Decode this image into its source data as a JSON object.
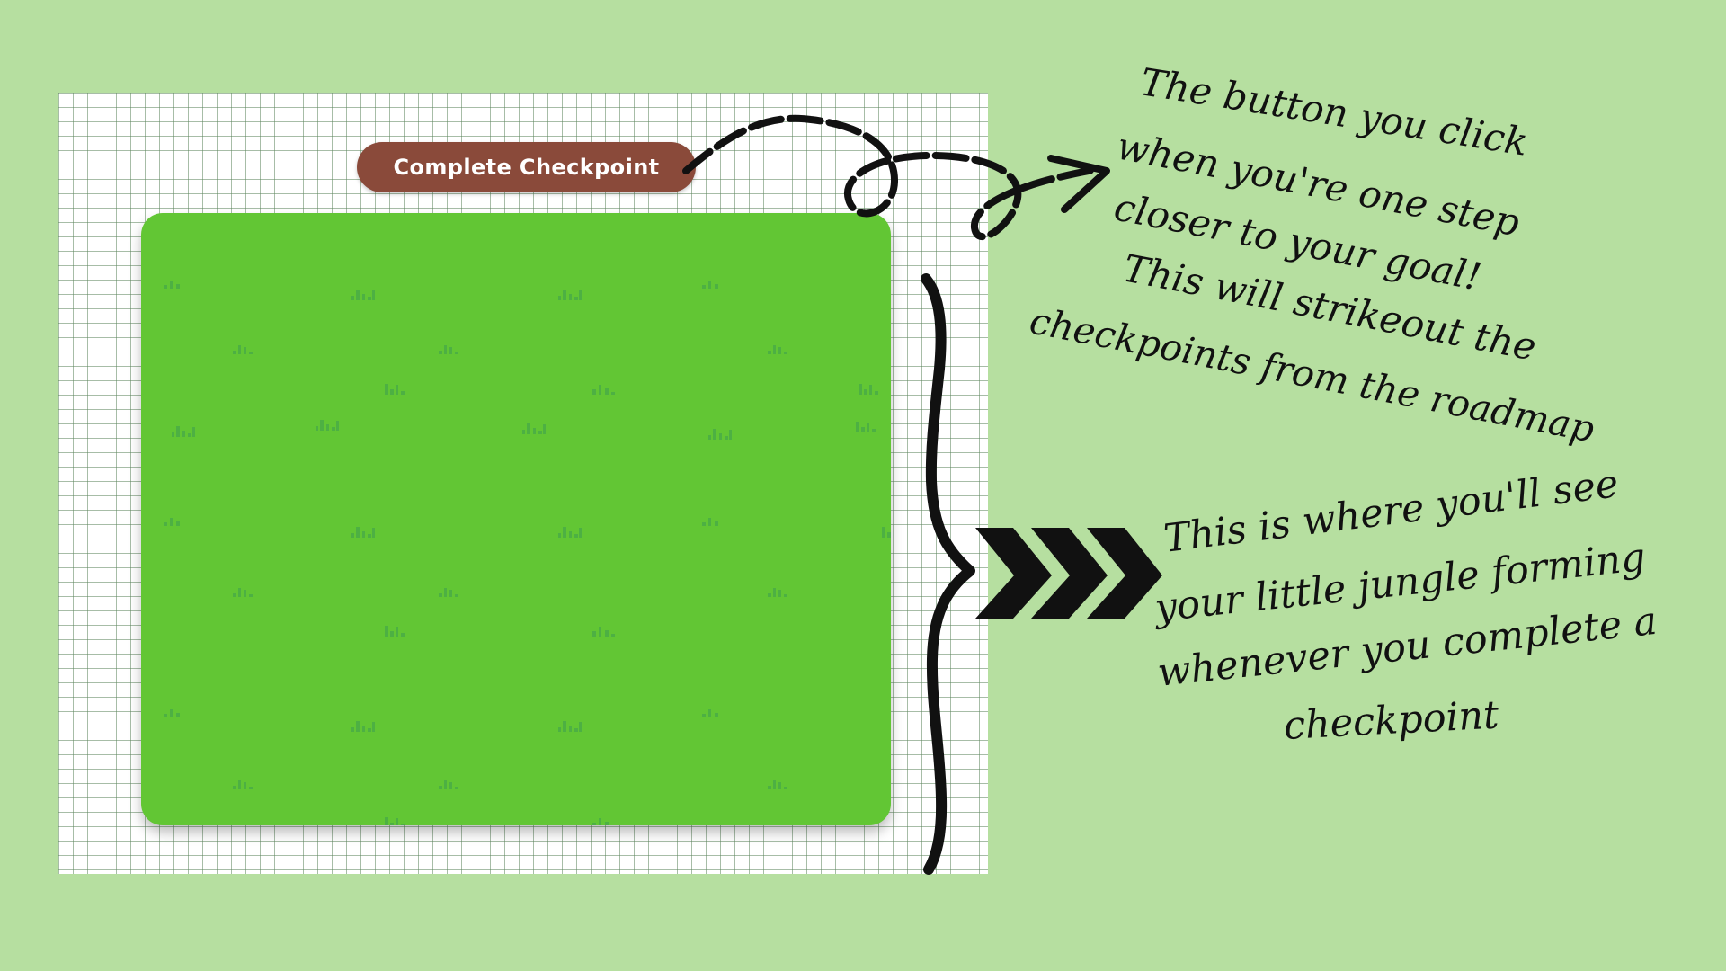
{
  "button": {
    "label": "Complete Checkpoint",
    "background": "#8a4a3a",
    "text_color": "#ffffff"
  },
  "annotations": {
    "button_note": {
      "lines": [
        "The button you click",
        "when you're one  step",
        "closer to your goal!",
        "This will strikeout the",
        "checkpoints from the roadmap"
      ]
    },
    "jungle_note": {
      "lines": [
        "This is where you'll see",
        "your little jungle forming",
        "whenever you complete a",
        "checkpoint"
      ]
    }
  },
  "colors": {
    "page_background": "#b6dfa0",
    "grid_panel": "#ffffff",
    "grid_lines": "#5f875f",
    "jungle_area": "#62c634",
    "grass_pattern": "#45a84a",
    "ink": "#111111"
  },
  "icons": {
    "pointer": "dashed-curly-arrow-icon",
    "brace": "curly-brace-icon",
    "chevrons": "triple-chevron-icon",
    "grass": "pixel-grass-tuft-icon"
  }
}
